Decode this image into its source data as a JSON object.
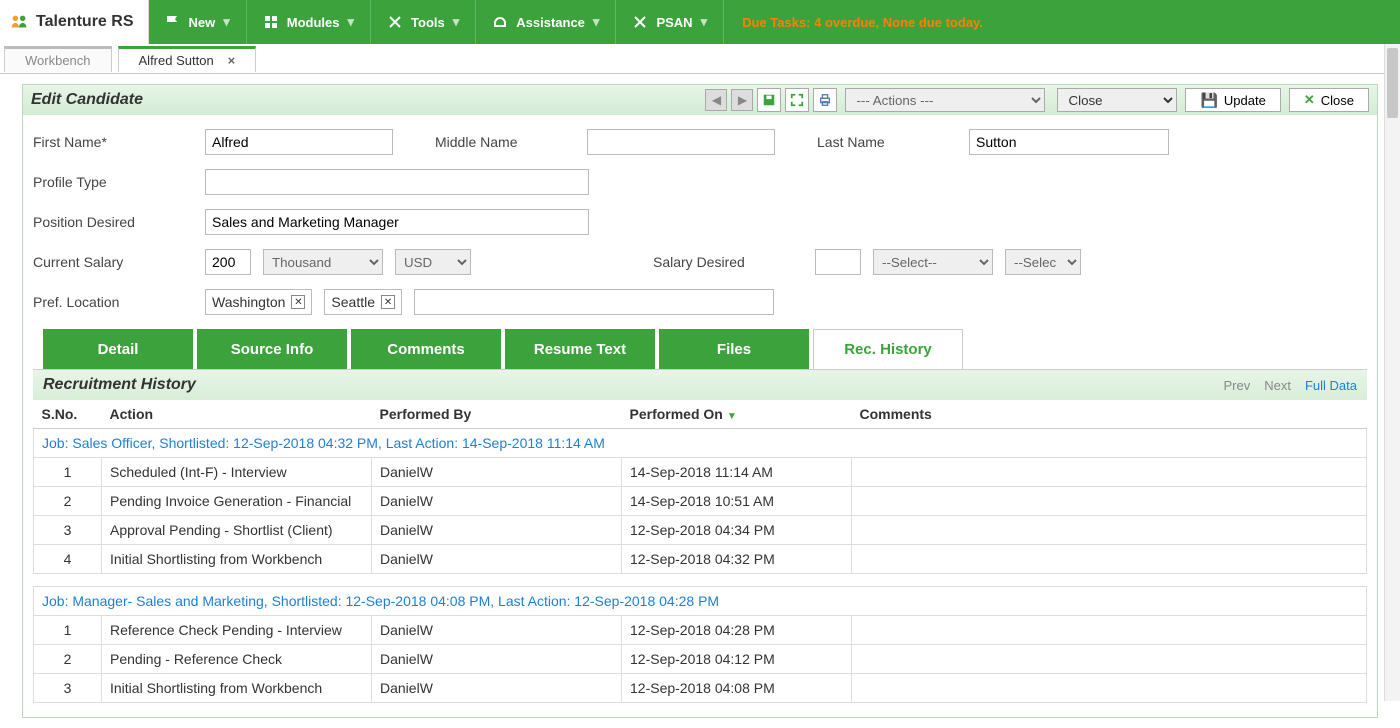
{
  "brand": "Talenture RS",
  "topmenu": [
    "New",
    "Modules",
    "Tools",
    "Assistance",
    "PSAN"
  ],
  "notification": "Due Tasks: 4 overdue, None due today.",
  "tabs": {
    "workbench": "Workbench",
    "active": "Alfred Sutton"
  },
  "header": {
    "title": "Edit Candidate",
    "actionsPlaceholder": "--- Actions ---",
    "closeSelect": "Close",
    "updateBtn": "Update",
    "closeBtn": "Close"
  },
  "form": {
    "firstNameLbl": "First Name*",
    "firstName": "Alfred",
    "middleNameLbl": "Middle Name",
    "middleName": "",
    "lastNameLbl": "Last Name",
    "lastName": "Sutton",
    "profileTypeLbl": "Profile Type",
    "profileType": "",
    "positionLbl": "Position Desired",
    "position": "Sales and Marketing Manager",
    "currSalaryLbl": "Current Salary",
    "currSalary": "200",
    "salaryUnit": "Thousand",
    "salaryCur": "USD",
    "desSalaryLbl": "Salary Desired",
    "desSalary": "",
    "desUnit": "--Select--",
    "desCur": "--Selec",
    "prefLocLbl": "Pref. Location",
    "loc1": "Washington",
    "loc2": "Seattle"
  },
  "subtabs": [
    "Detail",
    "Source Info",
    "Comments",
    "Resume Text",
    "Files",
    "Rec. History"
  ],
  "history": {
    "title": "Recruitment History",
    "prev": "Prev",
    "next": "Next",
    "full": "Full Data",
    "cols": [
      "S.No.",
      "Action",
      "Performed By",
      "Performed On",
      "Comments"
    ],
    "job1": "Job: Sales Officer, Shortlisted: 12-Sep-2018 04:32 PM, Last Action: 14-Sep-2018 11:14 AM",
    "job1rows": [
      {
        "n": "1",
        "action": "Scheduled (Int-F) - Interview",
        "by": "DanielW",
        "on": "14-Sep-2018 11:14 AM",
        "c": ""
      },
      {
        "n": "2",
        "action": "Pending Invoice Generation - Financial",
        "by": "DanielW",
        "on": "14-Sep-2018 10:51 AM",
        "c": ""
      },
      {
        "n": "3",
        "action": "Approval Pending - Shortlist (Client)",
        "by": "DanielW",
        "on": "12-Sep-2018 04:34 PM",
        "c": ""
      },
      {
        "n": "4",
        "action": "Initial Shortlisting from Workbench",
        "by": "DanielW",
        "on": "12-Sep-2018 04:32 PM",
        "c": ""
      }
    ],
    "job2": "Job: Manager- Sales and Marketing, Shortlisted: 12-Sep-2018 04:08 PM, Last Action: 12-Sep-2018 04:28 PM",
    "job2rows": [
      {
        "n": "1",
        "action": "Reference Check Pending - Interview",
        "by": "DanielW",
        "on": "12-Sep-2018 04:28 PM",
        "c": ""
      },
      {
        "n": "2",
        "action": "Pending - Reference Check",
        "by": "DanielW",
        "on": "12-Sep-2018 04:12 PM",
        "c": ""
      },
      {
        "n": "3",
        "action": "Initial Shortlisting from Workbench",
        "by": "DanielW",
        "on": "12-Sep-2018 04:08 PM",
        "c": ""
      }
    ]
  }
}
